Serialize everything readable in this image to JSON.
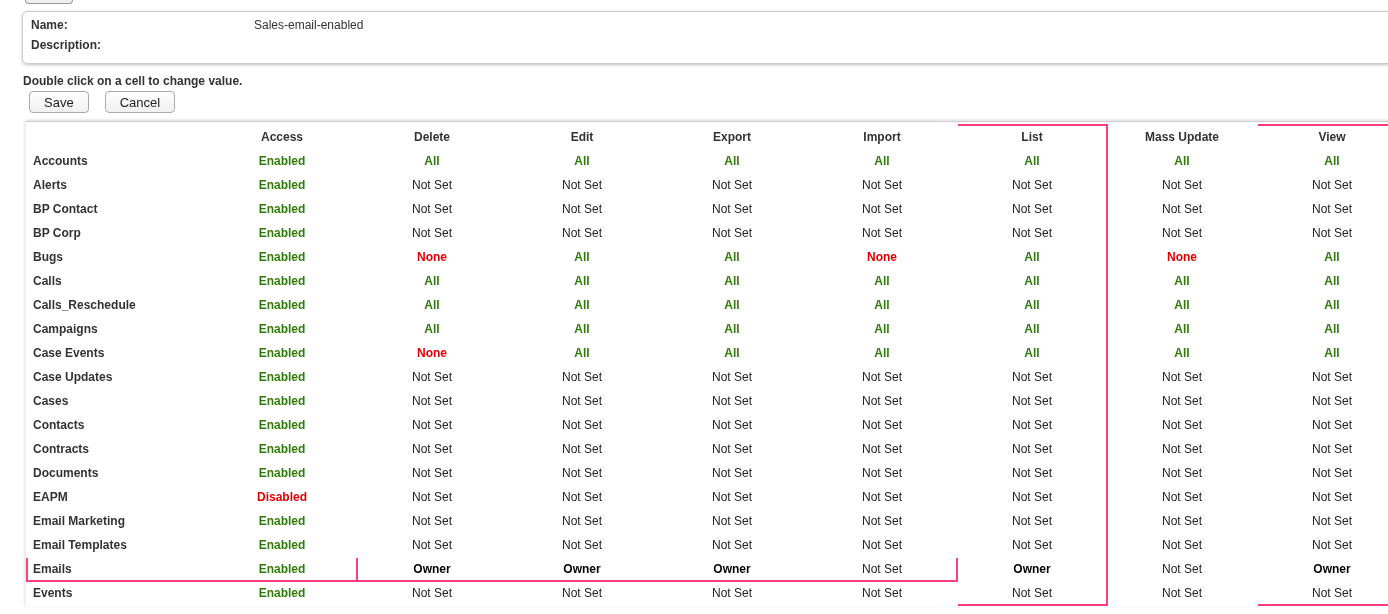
{
  "form": {
    "name_label": "Name:",
    "name_value": "Sales-email-enabled",
    "description_label": "Description:"
  },
  "hint": "Double click on a cell to change value.",
  "buttons": [
    "Save",
    "Cancel"
  ],
  "columns": [
    {
      "label": "Access",
      "highlighted": false
    },
    {
      "label": "Delete",
      "highlighted": false
    },
    {
      "label": "Edit",
      "highlighted": false
    },
    {
      "label": "Export",
      "highlighted": false
    },
    {
      "label": "Import",
      "highlighted": false
    },
    {
      "label": "List",
      "highlighted": true
    },
    {
      "label": "Mass Update",
      "highlighted": false
    },
    {
      "label": "View",
      "highlighted": true
    }
  ],
  "rows": [
    {
      "name": "Accounts",
      "highlighted": false,
      "actions_highlighted": false,
      "cells": [
        {
          "text": "Enabled",
          "kind": "positive"
        },
        {
          "text": "All",
          "kind": "positive"
        },
        {
          "text": "All",
          "kind": "positive"
        },
        {
          "text": "All",
          "kind": "positive"
        },
        {
          "text": "All",
          "kind": "positive"
        },
        {
          "text": "All",
          "kind": "positive"
        },
        {
          "text": "All",
          "kind": "positive"
        },
        {
          "text": "All",
          "kind": "positive"
        }
      ]
    },
    {
      "name": "Alerts",
      "highlighted": false,
      "actions_highlighted": false,
      "cells": [
        {
          "text": "Enabled",
          "kind": "positive"
        },
        {
          "text": "Not Set",
          "kind": "neutral"
        },
        {
          "text": "Not Set",
          "kind": "neutral"
        },
        {
          "text": "Not Set",
          "kind": "neutral"
        },
        {
          "text": "Not Set",
          "kind": "neutral"
        },
        {
          "text": "Not Set",
          "kind": "neutral"
        },
        {
          "text": "Not Set",
          "kind": "neutral"
        },
        {
          "text": "Not Set",
          "kind": "neutral"
        }
      ]
    },
    {
      "name": "BP Contact",
      "highlighted": false,
      "actions_highlighted": false,
      "cells": [
        {
          "text": "Enabled",
          "kind": "positive"
        },
        {
          "text": "Not Set",
          "kind": "neutral"
        },
        {
          "text": "Not Set",
          "kind": "neutral"
        },
        {
          "text": "Not Set",
          "kind": "neutral"
        },
        {
          "text": "Not Set",
          "kind": "neutral"
        },
        {
          "text": "Not Set",
          "kind": "neutral"
        },
        {
          "text": "Not Set",
          "kind": "neutral"
        },
        {
          "text": "Not Set",
          "kind": "neutral"
        }
      ]
    },
    {
      "name": "BP Corp",
      "highlighted": false,
      "actions_highlighted": false,
      "cells": [
        {
          "text": "Enabled",
          "kind": "positive"
        },
        {
          "text": "Not Set",
          "kind": "neutral"
        },
        {
          "text": "Not Set",
          "kind": "neutral"
        },
        {
          "text": "Not Set",
          "kind": "neutral"
        },
        {
          "text": "Not Set",
          "kind": "neutral"
        },
        {
          "text": "Not Set",
          "kind": "neutral"
        },
        {
          "text": "Not Set",
          "kind": "neutral"
        },
        {
          "text": "Not Set",
          "kind": "neutral"
        }
      ]
    },
    {
      "name": "Bugs",
      "highlighted": false,
      "actions_highlighted": false,
      "cells": [
        {
          "text": "Enabled",
          "kind": "positive"
        },
        {
          "text": "None",
          "kind": "negative"
        },
        {
          "text": "All",
          "kind": "positive"
        },
        {
          "text": "All",
          "kind": "positive"
        },
        {
          "text": "None",
          "kind": "negative"
        },
        {
          "text": "All",
          "kind": "positive"
        },
        {
          "text": "None",
          "kind": "negative"
        },
        {
          "text": "All",
          "kind": "positive"
        }
      ]
    },
    {
      "name": "Calls",
      "highlighted": false,
      "actions_highlighted": false,
      "cells": [
        {
          "text": "Enabled",
          "kind": "positive"
        },
        {
          "text": "All",
          "kind": "positive"
        },
        {
          "text": "All",
          "kind": "positive"
        },
        {
          "text": "All",
          "kind": "positive"
        },
        {
          "text": "All",
          "kind": "positive"
        },
        {
          "text": "All",
          "kind": "positive"
        },
        {
          "text": "All",
          "kind": "positive"
        },
        {
          "text": "All",
          "kind": "positive"
        }
      ]
    },
    {
      "name": "Calls_Reschedule",
      "highlighted": false,
      "actions_highlighted": false,
      "cells": [
        {
          "text": "Enabled",
          "kind": "positive"
        },
        {
          "text": "All",
          "kind": "positive"
        },
        {
          "text": "All",
          "kind": "positive"
        },
        {
          "text": "All",
          "kind": "positive"
        },
        {
          "text": "All",
          "kind": "positive"
        },
        {
          "text": "All",
          "kind": "positive"
        },
        {
          "text": "All",
          "kind": "positive"
        },
        {
          "text": "All",
          "kind": "positive"
        }
      ]
    },
    {
      "name": "Campaigns",
      "highlighted": false,
      "actions_highlighted": false,
      "cells": [
        {
          "text": "Enabled",
          "kind": "positive"
        },
        {
          "text": "All",
          "kind": "positive"
        },
        {
          "text": "All",
          "kind": "positive"
        },
        {
          "text": "All",
          "kind": "positive"
        },
        {
          "text": "All",
          "kind": "positive"
        },
        {
          "text": "All",
          "kind": "positive"
        },
        {
          "text": "All",
          "kind": "positive"
        },
        {
          "text": "All",
          "kind": "positive"
        }
      ]
    },
    {
      "name": "Case Events",
      "highlighted": false,
      "actions_highlighted": false,
      "cells": [
        {
          "text": "Enabled",
          "kind": "positive"
        },
        {
          "text": "None",
          "kind": "negative"
        },
        {
          "text": "All",
          "kind": "positive"
        },
        {
          "text": "All",
          "kind": "positive"
        },
        {
          "text": "All",
          "kind": "positive"
        },
        {
          "text": "All",
          "kind": "positive"
        },
        {
          "text": "All",
          "kind": "positive"
        },
        {
          "text": "All",
          "kind": "positive"
        }
      ]
    },
    {
      "name": "Case Updates",
      "highlighted": false,
      "actions_highlighted": false,
      "cells": [
        {
          "text": "Enabled",
          "kind": "positive"
        },
        {
          "text": "Not Set",
          "kind": "neutral"
        },
        {
          "text": "Not Set",
          "kind": "neutral"
        },
        {
          "text": "Not Set",
          "kind": "neutral"
        },
        {
          "text": "Not Set",
          "kind": "neutral"
        },
        {
          "text": "Not Set",
          "kind": "neutral"
        },
        {
          "text": "Not Set",
          "kind": "neutral"
        },
        {
          "text": "Not Set",
          "kind": "neutral"
        }
      ]
    },
    {
      "name": "Cases",
      "highlighted": false,
      "actions_highlighted": false,
      "cells": [
        {
          "text": "Enabled",
          "kind": "positive"
        },
        {
          "text": "Not Set",
          "kind": "neutral"
        },
        {
          "text": "Not Set",
          "kind": "neutral"
        },
        {
          "text": "Not Set",
          "kind": "neutral"
        },
        {
          "text": "Not Set",
          "kind": "neutral"
        },
        {
          "text": "Not Set",
          "kind": "neutral"
        },
        {
          "text": "Not Set",
          "kind": "neutral"
        },
        {
          "text": "Not Set",
          "kind": "neutral"
        }
      ]
    },
    {
      "name": "Contacts",
      "highlighted": false,
      "actions_highlighted": false,
      "cells": [
        {
          "text": "Enabled",
          "kind": "positive"
        },
        {
          "text": "Not Set",
          "kind": "neutral"
        },
        {
          "text": "Not Set",
          "kind": "neutral"
        },
        {
          "text": "Not Set",
          "kind": "neutral"
        },
        {
          "text": "Not Set",
          "kind": "neutral"
        },
        {
          "text": "Not Set",
          "kind": "neutral"
        },
        {
          "text": "Not Set",
          "kind": "neutral"
        },
        {
          "text": "Not Set",
          "kind": "neutral"
        }
      ]
    },
    {
      "name": "Contracts",
      "highlighted": false,
      "actions_highlighted": false,
      "cells": [
        {
          "text": "Enabled",
          "kind": "positive"
        },
        {
          "text": "Not Set",
          "kind": "neutral"
        },
        {
          "text": "Not Set",
          "kind": "neutral"
        },
        {
          "text": "Not Set",
          "kind": "neutral"
        },
        {
          "text": "Not Set",
          "kind": "neutral"
        },
        {
          "text": "Not Set",
          "kind": "neutral"
        },
        {
          "text": "Not Set",
          "kind": "neutral"
        },
        {
          "text": "Not Set",
          "kind": "neutral"
        }
      ]
    },
    {
      "name": "Documents",
      "highlighted": false,
      "actions_highlighted": false,
      "cells": [
        {
          "text": "Enabled",
          "kind": "positive"
        },
        {
          "text": "Not Set",
          "kind": "neutral"
        },
        {
          "text": "Not Set",
          "kind": "neutral"
        },
        {
          "text": "Not Set",
          "kind": "neutral"
        },
        {
          "text": "Not Set",
          "kind": "neutral"
        },
        {
          "text": "Not Set",
          "kind": "neutral"
        },
        {
          "text": "Not Set",
          "kind": "neutral"
        },
        {
          "text": "Not Set",
          "kind": "neutral"
        }
      ]
    },
    {
      "name": "EAPM",
      "highlighted": false,
      "actions_highlighted": false,
      "cells": [
        {
          "text": "Disabled",
          "kind": "negative"
        },
        {
          "text": "Not Set",
          "kind": "neutral"
        },
        {
          "text": "Not Set",
          "kind": "neutral"
        },
        {
          "text": "Not Set",
          "kind": "neutral"
        },
        {
          "text": "Not Set",
          "kind": "neutral"
        },
        {
          "text": "Not Set",
          "kind": "neutral"
        },
        {
          "text": "Not Set",
          "kind": "neutral"
        },
        {
          "text": "Not Set",
          "kind": "neutral"
        }
      ]
    },
    {
      "name": "Email Marketing",
      "highlighted": false,
      "actions_highlighted": false,
      "cells": [
        {
          "text": "Enabled",
          "kind": "positive"
        },
        {
          "text": "Not Set",
          "kind": "neutral"
        },
        {
          "text": "Not Set",
          "kind": "neutral"
        },
        {
          "text": "Not Set",
          "kind": "neutral"
        },
        {
          "text": "Not Set",
          "kind": "neutral"
        },
        {
          "text": "Not Set",
          "kind": "neutral"
        },
        {
          "text": "Not Set",
          "kind": "neutral"
        },
        {
          "text": "Not Set",
          "kind": "neutral"
        }
      ]
    },
    {
      "name": "Email Templates",
      "highlighted": false,
      "actions_highlighted": false,
      "cells": [
        {
          "text": "Enabled",
          "kind": "positive"
        },
        {
          "text": "Not Set",
          "kind": "neutral"
        },
        {
          "text": "Not Set",
          "kind": "neutral"
        },
        {
          "text": "Not Set",
          "kind": "neutral"
        },
        {
          "text": "Not Set",
          "kind": "neutral"
        },
        {
          "text": "Not Set",
          "kind": "neutral"
        },
        {
          "text": "Not Set",
          "kind": "neutral"
        },
        {
          "text": "Not Set",
          "kind": "neutral"
        }
      ]
    },
    {
      "name": "Emails",
      "highlighted": true,
      "actions_highlighted": true,
      "cells": [
        {
          "text": "Enabled",
          "kind": "positive"
        },
        {
          "text": "Owner",
          "kind": "owner"
        },
        {
          "text": "Owner",
          "kind": "owner"
        },
        {
          "text": "Owner",
          "kind": "owner"
        },
        {
          "text": "Not Set",
          "kind": "neutral"
        },
        {
          "text": "Owner",
          "kind": "owner"
        },
        {
          "text": "Not Set",
          "kind": "neutral"
        },
        {
          "text": "Owner",
          "kind": "owner"
        }
      ]
    },
    {
      "name": "Events",
      "highlighted": false,
      "actions_highlighted": false,
      "cells": [
        {
          "text": "Enabled",
          "kind": "positive"
        },
        {
          "text": "Not Set",
          "kind": "neutral"
        },
        {
          "text": "Not Set",
          "kind": "neutral"
        },
        {
          "text": "Not Set",
          "kind": "neutral"
        },
        {
          "text": "Not Set",
          "kind": "neutral"
        },
        {
          "text": "Not Set",
          "kind": "neutral"
        },
        {
          "text": "Not Set",
          "kind": "neutral"
        },
        {
          "text": "Not Set",
          "kind": "neutral"
        }
      ]
    }
  ]
}
